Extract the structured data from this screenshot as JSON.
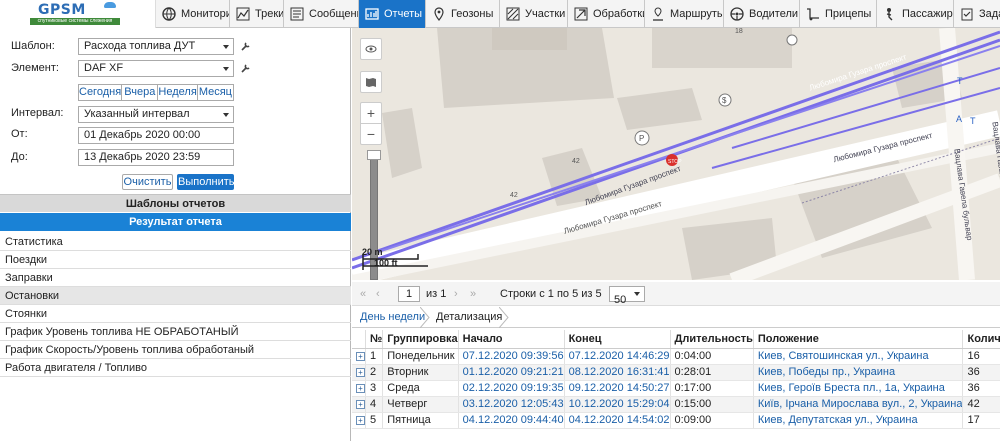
{
  "header": {
    "logo_text": "GPSM",
    "logo_tagline": "спутниковые системы слежения",
    "tabs": [
      {
        "label": "Мониторинг",
        "icon": "globe-icon"
      },
      {
        "label": "Треки",
        "icon": "track-icon"
      },
      {
        "label": "Сообщения",
        "icon": "messages-icon"
      },
      {
        "label": "Отчеты",
        "icon": "reports-icon",
        "active": true
      },
      {
        "label": "Геозоны",
        "icon": "geozone-icon"
      },
      {
        "label": "Участки",
        "icon": "sections-icon"
      },
      {
        "label": "Обработки",
        "icon": "processing-icon"
      },
      {
        "label": "Маршруты",
        "icon": "route-icon"
      },
      {
        "label": "Водители",
        "icon": "driver-icon"
      },
      {
        "label": "Прицепы",
        "icon": "trailer-icon"
      },
      {
        "label": "Пассажиры",
        "icon": "passenger-icon"
      },
      {
        "label": "Задачи",
        "icon": "tasks-icon"
      }
    ]
  },
  "form": {
    "template_label": "Шаблон:",
    "template_value": "Расхода топлива ДУТ",
    "element_label": "Элемент:",
    "element_value": "DAF XF",
    "quick": [
      "Сегодня",
      "Вчера",
      "Неделя",
      "Месяц"
    ],
    "interval_label": "Интервал:",
    "interval_value": "Указанный интервал",
    "from_label": "От:",
    "from_value": "01 Декабрь 2020 00:00",
    "to_label": "До:",
    "to_value": "13 Декабрь 2020 23:59",
    "clear_label": "Очистить",
    "run_label": "Выполнить"
  },
  "sections": {
    "templates": "Шаблоны отчетов",
    "result": "Результат отчета"
  },
  "result_items": [
    "Статистика",
    "Поездки",
    "Заправки",
    "Остановки",
    "Стоянки",
    "График Уровень топлива НЕ ОБРАБОТАНЫЙ",
    "График Скорость/Уровень топлива обработаный",
    "Работа двигателя / Топливо"
  ],
  "map": {
    "scale_m": "20 m",
    "scale_ft": "100 ft",
    "street_labels": [
      "Любомира Гузара проспект",
      "Любомира Гузара проспект",
      "Любомира Гузара проспект",
      "Любомира Гузара проспект",
      "Вацлава Гавела бульвар",
      "Вацлава Гавела бульвар"
    ],
    "house_numbers": [
      "18",
      "42",
      "42"
    ],
    "map_letters": [
      "T",
      "T",
      "A"
    ]
  },
  "pager": {
    "page_value": "1",
    "of_label": "из 1",
    "rows_label": "Строки с 1 по 5 из 5",
    "page_size": "50"
  },
  "subtabs": [
    "День недели",
    "Детализация"
  ],
  "table": {
    "headers": [
      "№",
      "Группировка",
      "Начало",
      "Конец",
      "Длительность",
      "Положение",
      "Количество"
    ],
    "rows": [
      [
        "1",
        "Понедельник",
        "07.12.2020 09:39:56",
        "07.12.2020 14:46:29",
        "0:04:00",
        "Киев, Святошинская ул., Украина",
        "16"
      ],
      [
        "2",
        "Вторник",
        "01.12.2020 09:21:21",
        "08.12.2020 16:31:41",
        "0:28:01",
        "Киев, Победы пр., Украина",
        "36"
      ],
      [
        "3",
        "Среда",
        "02.12.2020 09:19:35",
        "09.12.2020 14:50:27",
        "0:17:00",
        "Киев, Героїв Бреста пл., 1а, Украина",
        "36"
      ],
      [
        "4",
        "Четверг",
        "03.12.2020 12:05:43",
        "10.12.2020 15:29:04",
        "0:15:00",
        "Київ, Ірчана Мирослава вул., 2, Украина",
        "42"
      ],
      [
        "5",
        "Пятница",
        "04.12.2020 09:44:40",
        "04.12.2020 14:54:02",
        "0:09:00",
        "Киев, Депутатская ул., Украина",
        "17"
      ]
    ]
  }
}
